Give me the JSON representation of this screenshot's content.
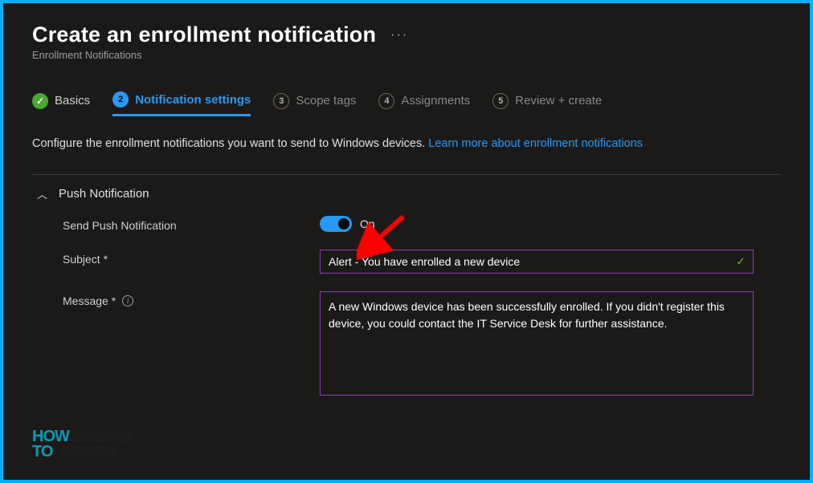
{
  "header": {
    "title": "Create an enrollment notification",
    "breadcrumb": "Enrollment Notifications"
  },
  "tabs": [
    {
      "label": "Basics",
      "state": "completed",
      "badge": "✓"
    },
    {
      "label": "Notification settings",
      "state": "active",
      "badge": "2"
    },
    {
      "label": "Scope tags",
      "state": "pending",
      "badge": "3"
    },
    {
      "label": "Assignments",
      "state": "pending",
      "badge": "4"
    },
    {
      "label": "Review + create",
      "state": "pending",
      "badge": "5"
    }
  ],
  "description": {
    "text": "Configure the enrollment notifications you want to send to Windows devices. ",
    "link_text": "Learn more about enrollment notifications"
  },
  "section": {
    "title": "Push Notification",
    "expanded": true,
    "fields": {
      "send_push": {
        "label": "Send Push Notification",
        "state_label": "On",
        "value": true
      },
      "subject": {
        "label": "Subject *",
        "value": "Alert - You have enrolled a new device",
        "valid": true
      },
      "message": {
        "label": "Message *",
        "has_info": true,
        "value": "A new Windows device has been successfully enrolled. If you didn't register this device, you could contact the IT Service Desk for further assistance."
      }
    }
  },
  "annotation": {
    "arrow_color": "#ff0000"
  },
  "watermark": {
    "line1_a": "HOW",
    "line1_b": "MANAGE",
    "line2_a": "TO",
    "line2_b": "DEVICES"
  }
}
